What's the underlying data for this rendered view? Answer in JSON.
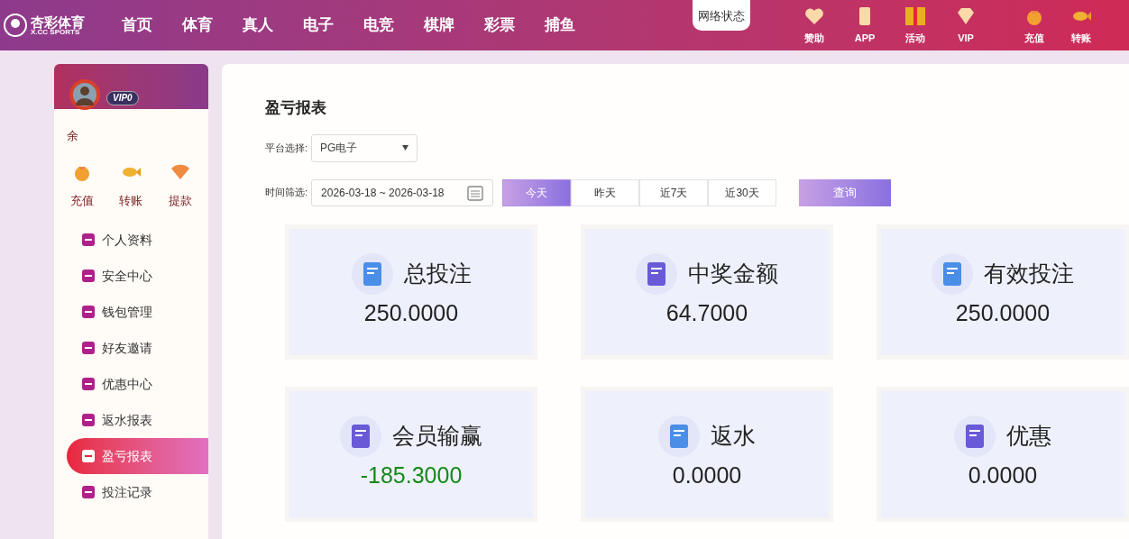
{
  "header": {
    "logo_title": "杏彩体育",
    "logo_subtitle": "X.CC SPORTS",
    "nav": [
      {
        "label": "首页"
      },
      {
        "label": "体育"
      },
      {
        "label": "真人"
      },
      {
        "label": "电子"
      },
      {
        "label": "电竞"
      },
      {
        "label": "棋牌"
      },
      {
        "label": "彩票"
      },
      {
        "label": "捕鱼"
      }
    ],
    "network_status": "网络状态",
    "tools": [
      {
        "label": "赞助",
        "kind": "heart"
      },
      {
        "label": "APP",
        "kind": "phone"
      },
      {
        "label": "活动",
        "kind": "gift"
      },
      {
        "label": "VIP",
        "kind": "diamond"
      }
    ],
    "wallet": [
      {
        "label": "充值",
        "kind": "bag"
      },
      {
        "label": "转账",
        "kind": "fish"
      }
    ]
  },
  "sidebar": {
    "vip": "VIP0",
    "balance_label": "余",
    "actions": [
      {
        "label": "充值",
        "kind": "bag"
      },
      {
        "label": "转账",
        "kind": "fish"
      },
      {
        "label": "提款",
        "kind": "fan"
      }
    ],
    "items": [
      {
        "label": "个人资料",
        "selected": false
      },
      {
        "label": "安全中心",
        "selected": false
      },
      {
        "label": "钱包管理",
        "selected": false
      },
      {
        "label": "好友邀请",
        "selected": false
      },
      {
        "label": "优惠中心",
        "selected": false
      },
      {
        "label": "返水报表",
        "selected": false
      },
      {
        "label": "盈亏报表",
        "selected": true
      },
      {
        "label": "投注记录",
        "selected": false
      }
    ]
  },
  "report": {
    "title": "盈亏报表",
    "platform_label": "平台选择:",
    "platform_value": "PG电子",
    "time_label": "时间筛选:",
    "date_range": "2026-03-18 ~ 2026-03-18",
    "ranges": [
      {
        "label": "今天",
        "selected": true
      },
      {
        "label": "昨天",
        "selected": false
      },
      {
        "label": "近7天",
        "selected": false
      },
      {
        "label": "近30天",
        "selected": false
      }
    ],
    "query_button": "查询",
    "stats": [
      {
        "label": "总投注",
        "value": "250.0000",
        "color": "#222222"
      },
      {
        "label": "中奖金额",
        "value": "64.7000",
        "color": "#222222"
      },
      {
        "label": "有效投注",
        "value": "250.0000",
        "color": "#222222"
      },
      {
        "label": "会员输赢",
        "value": "-185.3000",
        "color": "#138a17"
      },
      {
        "label": "返水",
        "value": "0.0000",
        "color": "#222222"
      },
      {
        "label": "优惠",
        "value": "0.0000",
        "color": "#222222"
      }
    ]
  }
}
